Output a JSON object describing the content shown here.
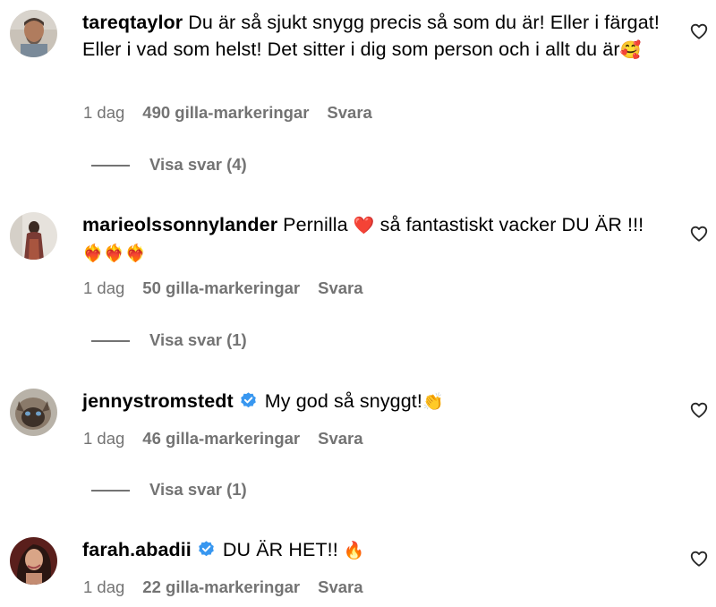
{
  "comments": [
    {
      "username": "tareqtaylor",
      "verified": false,
      "text": "Du är så sjukt snygg precis så som du är! Eller i färgat! Eller i vad som helst! Det sitter i dig som person och i allt du är",
      "emoji": "🥰",
      "time": "1 dag",
      "likes": "490 gilla-markeringar",
      "reply_label": "Svara",
      "view_replies": "Visa svar (4)"
    },
    {
      "username": "marieolssonnylander",
      "verified": false,
      "text_a": "Pernilla",
      "emoji_a": "❤️",
      "text_b": "så fantastiskt vacker DU ÄR !!!",
      "emoji_b": "❤️‍🔥❤️‍🔥❤️‍🔥",
      "time": "1 dag",
      "likes": "50 gilla-markeringar",
      "reply_label": "Svara",
      "view_replies": "Visa svar (1)"
    },
    {
      "username": "jennystromstedt",
      "verified": true,
      "text": "My god så snyggt!",
      "emoji": "👏",
      "time": "1 dag",
      "likes": "46 gilla-markeringar",
      "reply_label": "Svara",
      "view_replies": "Visa svar (1)"
    },
    {
      "username": "farah.abadii",
      "verified": true,
      "text": "DU ÄR HET!!",
      "emoji": "🔥",
      "time": "1 dag",
      "likes": "22 gilla-markeringar",
      "reply_label": "Svara"
    }
  ],
  "icons": {
    "like": "heart-outline-icon",
    "verified": "verified-badge-icon"
  },
  "colors": {
    "text_primary": "#000000",
    "text_secondary": "#737373",
    "verified_blue": "#3897f0",
    "background": "#ffffff"
  }
}
